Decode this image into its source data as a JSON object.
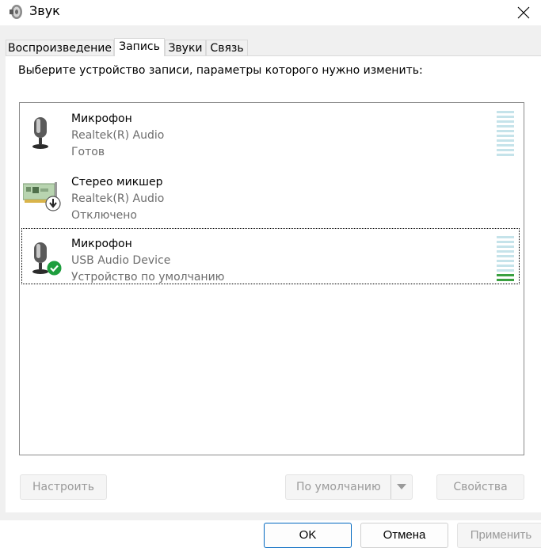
{
  "window": {
    "title": "Звук",
    "close_icon": "close-icon"
  },
  "tabs": [
    {
      "label": "Воспроизведение",
      "active": false
    },
    {
      "label": "Запись",
      "active": true
    },
    {
      "label": "Звуки",
      "active": false
    },
    {
      "label": "Связь",
      "active": false
    }
  ],
  "instruction": "Выберите устройство записи, параметры которого нужно изменить:",
  "devices": [
    {
      "name": "Микрофон",
      "driver": "Realtek(R) Audio",
      "status": "Готов",
      "icon": "microphone-icon",
      "selected": false,
      "level_fraction": 0
    },
    {
      "name": "Стерео микшер",
      "driver": "Realtek(R) Audio",
      "status": "Отключено",
      "icon": "sound-card-icon",
      "badge": "disabled-arrow-icon",
      "selected": false
    },
    {
      "name": "Микрофон",
      "driver": "USB Audio Device",
      "status": "Устройство по умолчанию",
      "icon": "microphone-icon",
      "badge": "default-check-icon",
      "selected": true,
      "level_fraction": 0.2
    }
  ],
  "buttons": {
    "configure": "Настроить",
    "set_default": "По умолчанию",
    "properties": "Свойства",
    "ok": "OK",
    "cancel": "Отмена",
    "apply": "Применить"
  },
  "colors": {
    "accent": "#0067c0",
    "meter_off": "#c5e3ea",
    "meter_on": "#3aa040",
    "default_check": "#1e9e3e"
  }
}
